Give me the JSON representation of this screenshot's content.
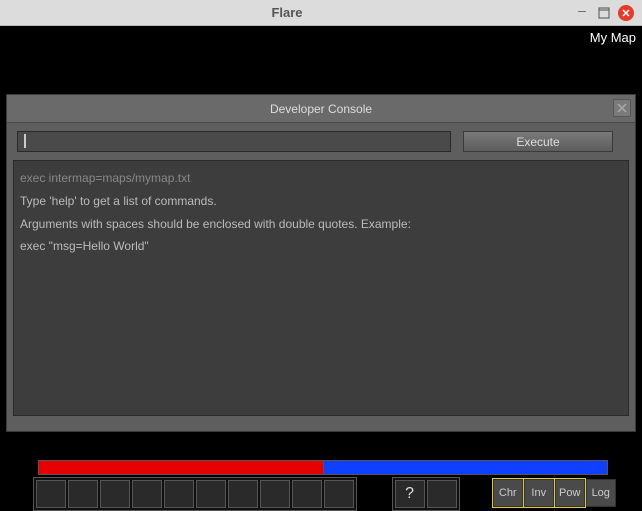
{
  "window": {
    "title": "Flare"
  },
  "game": {
    "map_name": "My Map"
  },
  "console": {
    "title": "Developer Console",
    "input_value": "",
    "execute_label": "Execute",
    "lines": [
      "exec intermap=maps/mymap.txt",
      "Type 'help' to get a list of commands.",
      "Arguments with spaces should be enclosed with double quotes. Example:",
      "exec \"msg=Hello World\""
    ]
  },
  "hud": {
    "help_label": "?",
    "menu": {
      "chr": "Chr",
      "inv": "Inv",
      "pow": "Pow",
      "log": "Log"
    }
  }
}
